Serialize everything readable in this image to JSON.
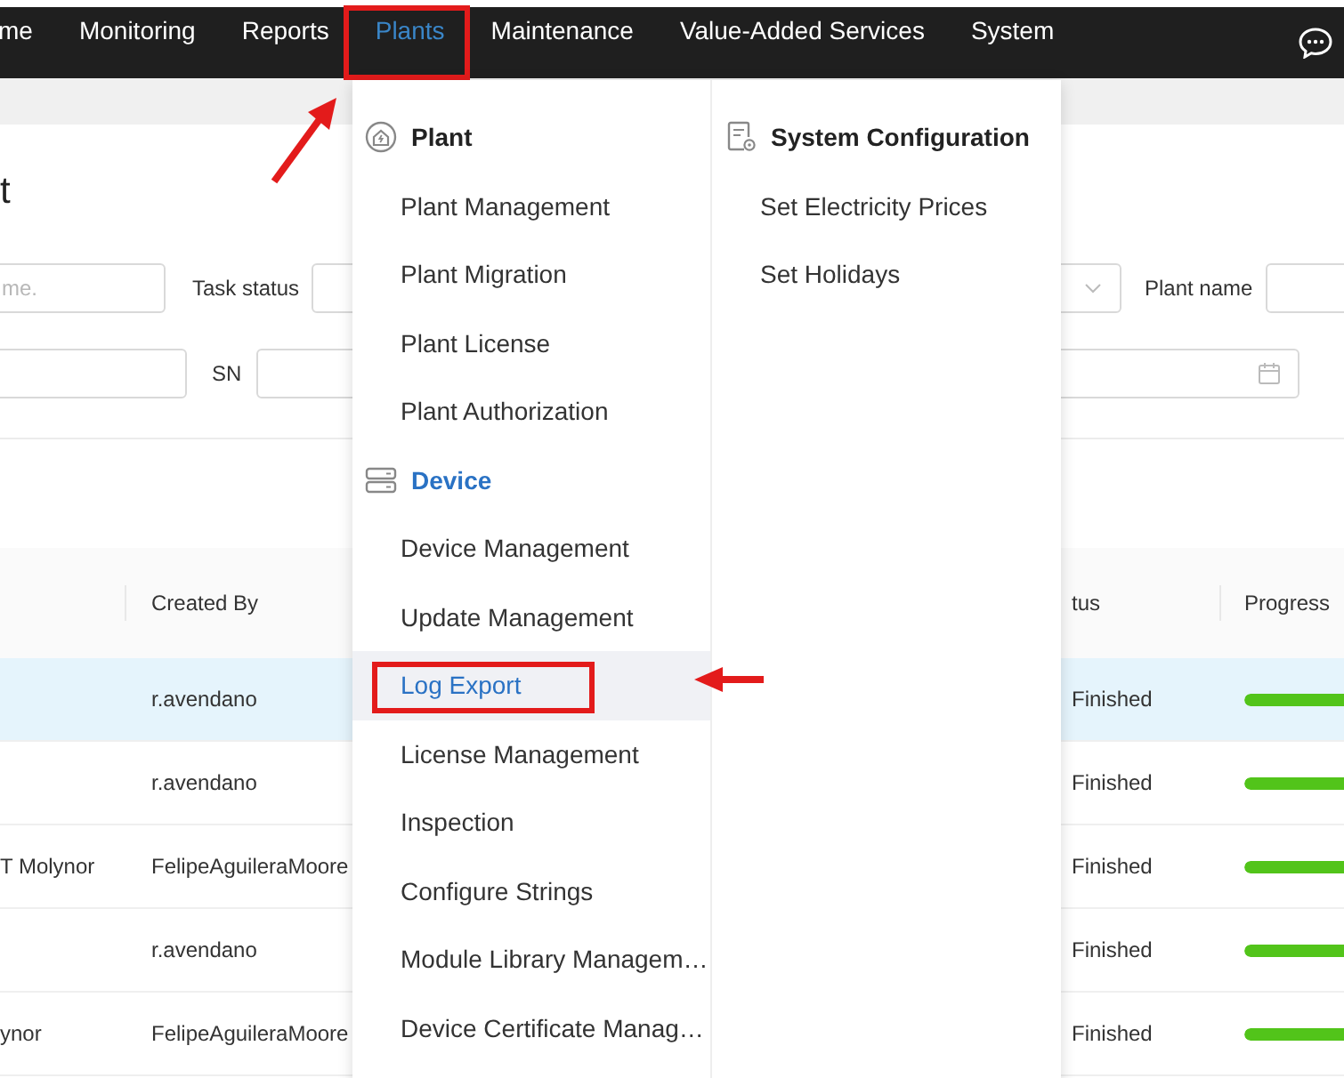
{
  "nav": {
    "items": [
      {
        "label": "me",
        "selected": false,
        "marked": false
      },
      {
        "label": "Monitoring",
        "selected": false,
        "marked": false
      },
      {
        "label": "Reports",
        "selected": false,
        "marked": false
      },
      {
        "label": "Plants",
        "selected": true,
        "marked": true
      },
      {
        "label": "Maintenance",
        "selected": false,
        "marked": false
      },
      {
        "label": "Value-Added Services",
        "selected": false,
        "marked": false
      },
      {
        "label": "System",
        "selected": false,
        "marked": false
      }
    ]
  },
  "page": {
    "title": "t",
    "filters": {
      "name_field": {
        "placeholder": "me."
      },
      "task_status_label": "Task status",
      "plant_name_label": "Plant name",
      "sn_label": "SN"
    },
    "table": {
      "columns": [
        "Created By",
        "tus",
        "Progress"
      ],
      "rows": [
        {
          "column_1": null,
          "created_by": "r.avendano",
          "status": "Finished",
          "progress": {
            "level": 1
          },
          "selected": true
        },
        {
          "column_1": null,
          "created_by": "r.avendano",
          "status": "Finished",
          "progress": {
            "level": 1
          },
          "selected": false
        },
        {
          "column_1": "T Molynor",
          "created_by": "FelipeAguileraMoore",
          "status": "Finished",
          "progress": {
            "level": 1
          },
          "selected": false
        },
        {
          "column_1": null,
          "created_by": "r.avendano",
          "status": "Finished",
          "progress": {
            "level": 1
          },
          "selected": false
        },
        {
          "column_1": "ynor",
          "created_by": "FelipeAguileraMoore",
          "status": "Finished",
          "progress": {
            "level": 1
          },
          "selected": false
        }
      ]
    }
  },
  "menu": {
    "columns": [
      {
        "groups": [
          {
            "title": "Plant",
            "active": false,
            "items": [
              {
                "label": "Plant Management",
                "selected": false,
                "marked": false
              },
              {
                "label": "Plant Migration",
                "selected": false,
                "marked": false
              },
              {
                "label": "Plant License",
                "selected": false,
                "marked": false
              },
              {
                "label": "Plant Authorization",
                "selected": false,
                "marked": false
              }
            ]
          },
          {
            "title": "Device",
            "active": true,
            "items": [
              {
                "label": "Device Management",
                "selected": false,
                "marked": false
              },
              {
                "label": "Update Management",
                "selected": false,
                "marked": false
              },
              {
                "label": "Log Export",
                "selected": true,
                "marked": true
              },
              {
                "label": "License Management",
                "selected": false,
                "marked": false
              },
              {
                "label": "Inspection",
                "selected": false,
                "marked": false
              },
              {
                "label": "Configure Strings",
                "selected": false,
                "marked": false
              },
              {
                "label": "Module Library Managem…",
                "selected": false,
                "marked": false
              },
              {
                "label": "Device Certificate Manag…",
                "selected": false,
                "marked": false
              }
            ]
          }
        ]
      },
      {
        "groups": [
          {
            "title": "System Configuration",
            "active": false,
            "items": [
              {
                "label": "Set Electricity Prices",
                "selected": false,
                "marked": false
              },
              {
                "label": "Set Holidays",
                "selected": false,
                "marked": false
              }
            ]
          }
        ]
      }
    ]
  }
}
